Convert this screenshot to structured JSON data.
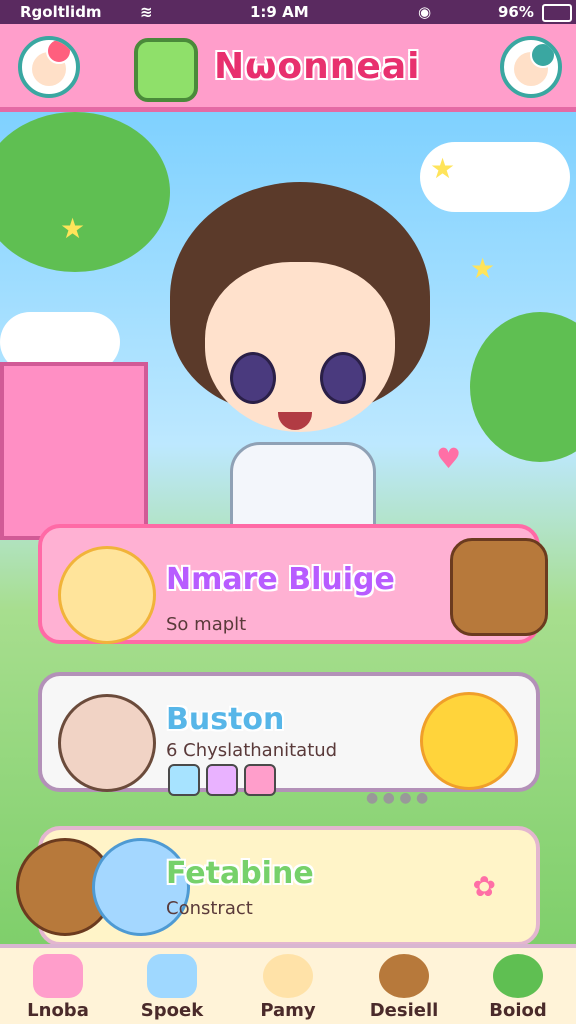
{
  "status": {
    "left_text": "Rgoltlidm",
    "time": "1:9 AM",
    "battery": "96%"
  },
  "header": {
    "title": "Nωonneai"
  },
  "cards": [
    {
      "title": "Nmare Bluige",
      "subtitle": "So maplt"
    },
    {
      "title": "Buston",
      "subtitle": "6 Chyslathanitatud"
    },
    {
      "title": "Fetabine",
      "subtitle": "Constract"
    }
  ],
  "tabs": [
    {
      "label": "Lnoba"
    },
    {
      "label": "Spoek"
    },
    {
      "label": "Pamy"
    },
    {
      "label": "Desiell"
    },
    {
      "label": "Boiod"
    }
  ],
  "colors": {
    "primary": "#ff9ecb",
    "accent": "#e8306e",
    "tabbar": "#fff3d8"
  }
}
